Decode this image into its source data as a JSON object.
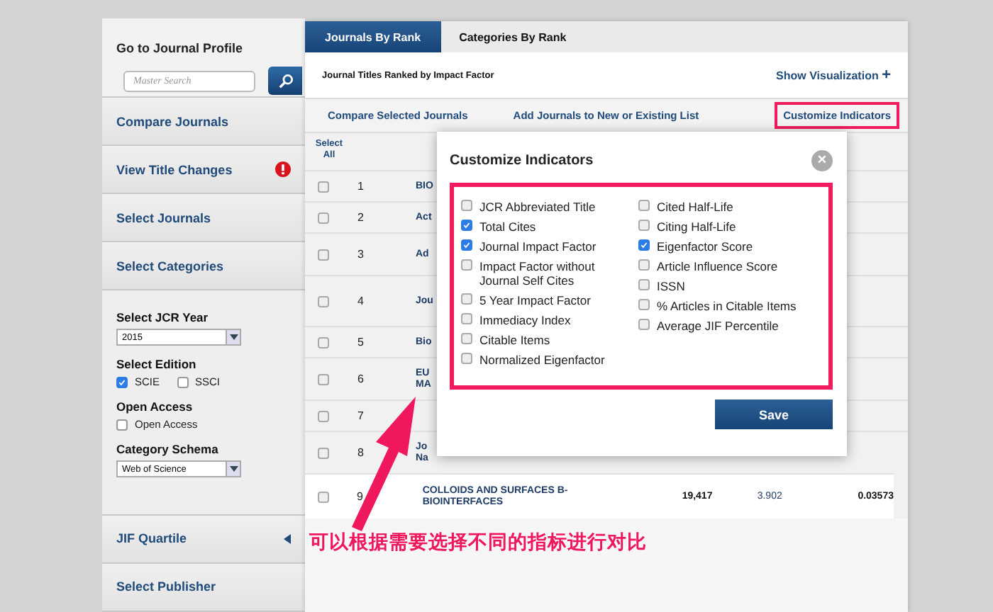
{
  "sidebar": {
    "profile": {
      "title": "Go to Journal Profile",
      "placeholder": "Master Search"
    },
    "nav": [
      {
        "label": "Compare Journals",
        "alert": false
      },
      {
        "label": "View Title Changes",
        "alert": true
      },
      {
        "label": "Select Journals",
        "alert": false
      },
      {
        "label": "Select Categories",
        "alert": false
      }
    ],
    "filters": {
      "year_label": "Select JCR Year",
      "year": "2015",
      "edition_label": "Select Edition",
      "editions": [
        {
          "label": "SCIE",
          "checked": true
        },
        {
          "label": "SSCI",
          "checked": false
        }
      ],
      "open_access_label": "Open Access",
      "open_access": {
        "label": "Open Access",
        "checked": false
      },
      "schema_label": "Category Schema",
      "schema": "Web of Science"
    },
    "bottom_nav": [
      {
        "label": "JIF Quartile",
        "expanded": false
      },
      {
        "label": "Select Publisher"
      }
    ]
  },
  "tabs": [
    {
      "label": "Journals By Rank",
      "selected": true
    },
    {
      "label": "Categories By Rank",
      "selected": false
    }
  ],
  "heading": "Journal Titles Ranked by Impact Factor",
  "show_visualization": {
    "label": "Show Visualization",
    "icon": "+"
  },
  "actions": [
    {
      "label": "Compare Selected Journals",
      "highlighted": false
    },
    {
      "label": "Add Journals to New or Existing List",
      "highlighted": false
    },
    {
      "label": "Customize Indicators",
      "highlighted": true
    }
  ],
  "table": {
    "select_all": "Select All",
    "rows": [
      {
        "checked": false,
        "rank": "1",
        "title": "BIO"
      },
      {
        "checked": false,
        "rank": "2",
        "title": "Act"
      },
      {
        "checked": false,
        "rank": "3",
        "title": "Ad"
      },
      {
        "checked": false,
        "rank": "4",
        "title": "Jou"
      },
      {
        "checked": false,
        "rank": "5",
        "title": "Bio"
      },
      {
        "checked": false,
        "rank": "6",
        "title": "EU MA"
      },
      {
        "checked": false,
        "rank": "7"
      },
      {
        "checked": false,
        "rank": "8",
        "title": "Jo Na"
      },
      {
        "checked": false,
        "rank": "9",
        "title": "COLLOIDS AND SURFACES B-BIOINTERFACES",
        "total_cites": "19,417",
        "impact_factor": "3.902",
        "eigenfactor": "0.03573"
      }
    ]
  },
  "modal": {
    "title": "Customize Indicators",
    "close": "×",
    "columns": [
      [
        {
          "label": "JCR Abbreviated Title",
          "checked": false
        },
        {
          "label": "Total Cites",
          "checked": true
        },
        {
          "label": "Journal Impact Factor",
          "checked": true
        },
        {
          "label": "Impact Factor without Journal Self Cites",
          "checked": false
        },
        {
          "label": "5 Year Impact Factor",
          "checked": false
        },
        {
          "label": "Immediacy Index",
          "checked": false
        },
        {
          "label": "Citable Items",
          "checked": false
        },
        {
          "label": "Normalized Eigenfactor",
          "checked": false
        }
      ],
      [
        {
          "label": "Cited Half-Life",
          "checked": false
        },
        {
          "label": "Citing Half-Life",
          "checked": false
        },
        {
          "label": "Eigenfactor Score",
          "checked": true
        },
        {
          "label": "Article Influence Score",
          "checked": false
        },
        {
          "label": "ISSN",
          "checked": false
        },
        {
          "label": "% Articles in Citable Items",
          "checked": false
        },
        {
          "label": "Average JIF Percentile",
          "checked": false
        }
      ]
    ],
    "save": "Save"
  },
  "annotation": "可以根据需要选择不同的指标进行对比"
}
